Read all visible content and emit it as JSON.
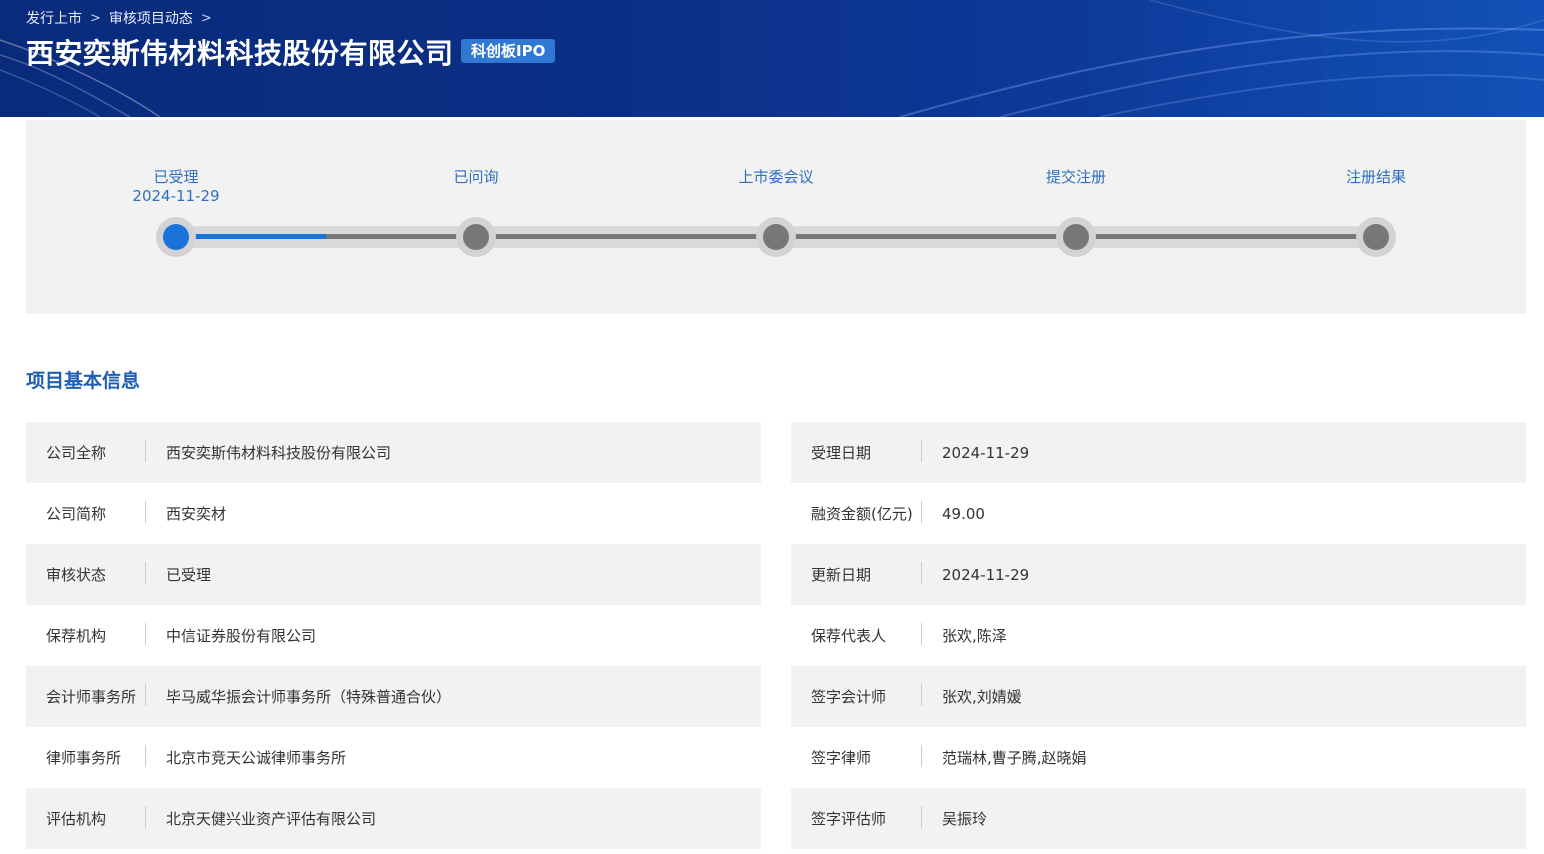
{
  "breadcrumb": {
    "item1": "发行上市",
    "item2": "审核项目动态",
    "separator": ">"
  },
  "header": {
    "company_title": "西安奕斯伟材料科技股份有限公司",
    "board_tag": "科创板IPO"
  },
  "timeline": {
    "progress_fraction": 0.125,
    "stages": [
      {
        "label": "已受理",
        "date": "2024-11-29",
        "active": true
      },
      {
        "label": "已问询",
        "date": "",
        "active": false
      },
      {
        "label": "上市委会议",
        "date": "",
        "active": false
      },
      {
        "label": "提交注册",
        "date": "",
        "active": false
      },
      {
        "label": "注册结果",
        "date": "",
        "active": false
      }
    ]
  },
  "section": {
    "title": "项目基本信息"
  },
  "info_left": [
    {
      "label": "公司全称",
      "value": "西安奕斯伟材料科技股份有限公司"
    },
    {
      "label": "公司简称",
      "value": "西安奕材"
    },
    {
      "label": "审核状态",
      "value": "已受理"
    },
    {
      "label": "保荐机构",
      "value": "中信证券股份有限公司"
    },
    {
      "label": "会计师事务所",
      "value": "毕马威华振会计师事务所（特殊普通合伙）"
    },
    {
      "label": "律师事务所",
      "value": "北京市竞天公诚律师事务所"
    },
    {
      "label": "评估机构",
      "value": "北京天健兴业资产评估有限公司"
    }
  ],
  "info_right": [
    {
      "label": "受理日期",
      "value": "2024-11-29"
    },
    {
      "label": "融资金额(亿元)",
      "value": "49.00"
    },
    {
      "label": "更新日期",
      "value": "2024-11-29"
    },
    {
      "label": "保荐代表人",
      "value": "张欢,陈泽"
    },
    {
      "label": "签字会计师",
      "value": "张欢,刘婧媛"
    },
    {
      "label": "签字律师",
      "value": "范瑞林,曹子腾,赵晓娟"
    },
    {
      "label": "签字评估师",
      "value": "吴振玲"
    }
  ],
  "colors": {
    "banner": "#0b2f86",
    "accent": "#1a73d9",
    "tag": "#2f79d4",
    "section_title": "#1f5eb0"
  }
}
